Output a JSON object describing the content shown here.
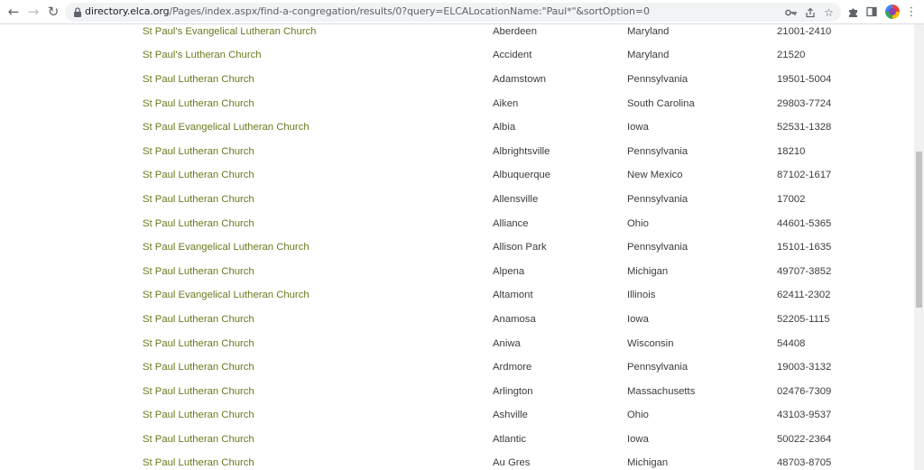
{
  "browser": {
    "url_host": "directory.elca.org",
    "url_path": "/Pages/index.aspx/find-a-congregation/results/0?query=ELCALocationName:\"Paul*\"&sortOption=0",
    "icons": {
      "back": "back-arrow-icon",
      "forward": "forward-arrow-icon",
      "reload": "reload-icon",
      "lock": "lock-icon",
      "key": "key-icon",
      "share": "share-icon",
      "bookmark": "star-icon",
      "extensions": "puzzle-icon",
      "side_panel": "side-panel-icon",
      "menu": "kebab-menu-icon"
    }
  },
  "colors": {
    "link": "#6b7a1e",
    "text": "#3c3c3c",
    "omnibox": "#f1f3f4"
  },
  "results": [
    {
      "name": "St Paul's Evangelical Lutheran Church",
      "city": "Aberdeen",
      "state": "Maryland",
      "zip": "21001-2410"
    },
    {
      "name": "St Paul's Lutheran Church",
      "city": "Accident",
      "state": "Maryland",
      "zip": "21520"
    },
    {
      "name": "St Paul Lutheran Church",
      "city": "Adamstown",
      "state": "Pennsylvania",
      "zip": "19501-5004"
    },
    {
      "name": "St Paul Lutheran Church",
      "city": "Aiken",
      "state": "South Carolina",
      "zip": "29803-7724"
    },
    {
      "name": "St Paul Evangelical Lutheran Church",
      "city": "Albia",
      "state": "Iowa",
      "zip": "52531-1328"
    },
    {
      "name": "St Paul Lutheran Church",
      "city": "Albrightsville",
      "state": "Pennsylvania",
      "zip": "18210"
    },
    {
      "name": "St Paul Lutheran Church",
      "city": "Albuquerque",
      "state": "New Mexico",
      "zip": "87102-1617"
    },
    {
      "name": "St Paul Lutheran Church",
      "city": "Allensville",
      "state": "Pennsylvania",
      "zip": "17002"
    },
    {
      "name": "St Paul Lutheran Church",
      "city": "Alliance",
      "state": "Ohio",
      "zip": "44601-5365"
    },
    {
      "name": "St Paul Evangelical Lutheran Church",
      "city": "Allison Park",
      "state": "Pennsylvania",
      "zip": "15101-1635"
    },
    {
      "name": "St Paul Lutheran Church",
      "city": "Alpena",
      "state": "Michigan",
      "zip": "49707-3852"
    },
    {
      "name": "St Paul Evangelical Lutheran Church",
      "city": "Altamont",
      "state": "Illinois",
      "zip": "62411-2302"
    },
    {
      "name": "St Paul Lutheran Church",
      "city": "Anamosa",
      "state": "Iowa",
      "zip": "52205-1115"
    },
    {
      "name": "St Paul Lutheran Church",
      "city": "Aniwa",
      "state": "Wisconsin",
      "zip": "54408"
    },
    {
      "name": "St Paul Lutheran Church",
      "city": "Ardmore",
      "state": "Pennsylvania",
      "zip": "19003-3132"
    },
    {
      "name": "St Paul Lutheran Church",
      "city": "Arlington",
      "state": "Massachusetts",
      "zip": "02476-7309"
    },
    {
      "name": "St Paul Lutheran Church",
      "city": "Ashville",
      "state": "Ohio",
      "zip": "43103-9537"
    },
    {
      "name": "St Paul Lutheran Church",
      "city": "Atlantic",
      "state": "Iowa",
      "zip": "50022-2364"
    },
    {
      "name": "St Paul Lutheran Church",
      "city": "Au Gres",
      "state": "Michigan",
      "zip": "48703-8705"
    }
  ]
}
